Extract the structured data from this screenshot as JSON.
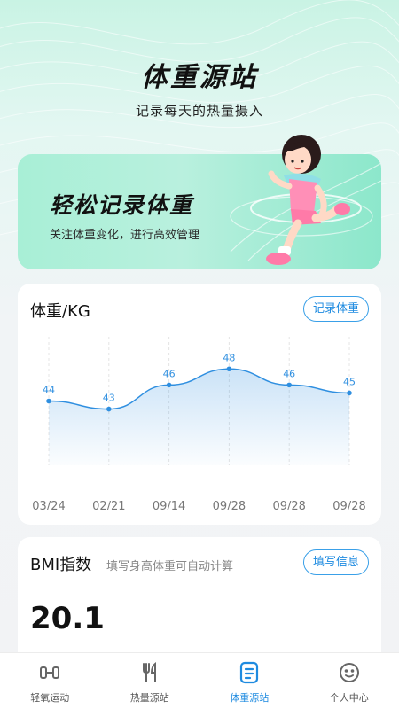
{
  "hero": {
    "title": "体重源站",
    "subtitle": "记录每天的热量摄入"
  },
  "banner": {
    "title": "轻松记录体重",
    "subtitle": "关注体重变化，进行高效管理"
  },
  "weight_card": {
    "title": "体重/KG",
    "record_button": "记录体重"
  },
  "chart_data": {
    "type": "area",
    "categories": [
      "03/24",
      "02/21",
      "09/14",
      "09/28",
      "09/28",
      "09/28"
    ],
    "values": [
      44,
      43,
      46,
      48,
      46,
      45
    ],
    "ylim": [
      36,
      52
    ],
    "grid": "vertical-dashed",
    "color": "#2f8fe0"
  },
  "bmi_card": {
    "title": "BMI指数",
    "hint": "填写身高体重可自动计算",
    "fill_button": "填写信息",
    "value": "20.1"
  },
  "tabbar": {
    "items": [
      {
        "label": "轻氧运动",
        "icon": "dumbbell-icon"
      },
      {
        "label": "热量源站",
        "icon": "fork-knife-icon"
      },
      {
        "label": "体重源站",
        "icon": "list-book-icon",
        "active": true
      },
      {
        "label": "个人中心",
        "icon": "face-icon"
      }
    ]
  },
  "colors": {
    "accent": "#1f8be0",
    "banner": "#a8efd6"
  }
}
